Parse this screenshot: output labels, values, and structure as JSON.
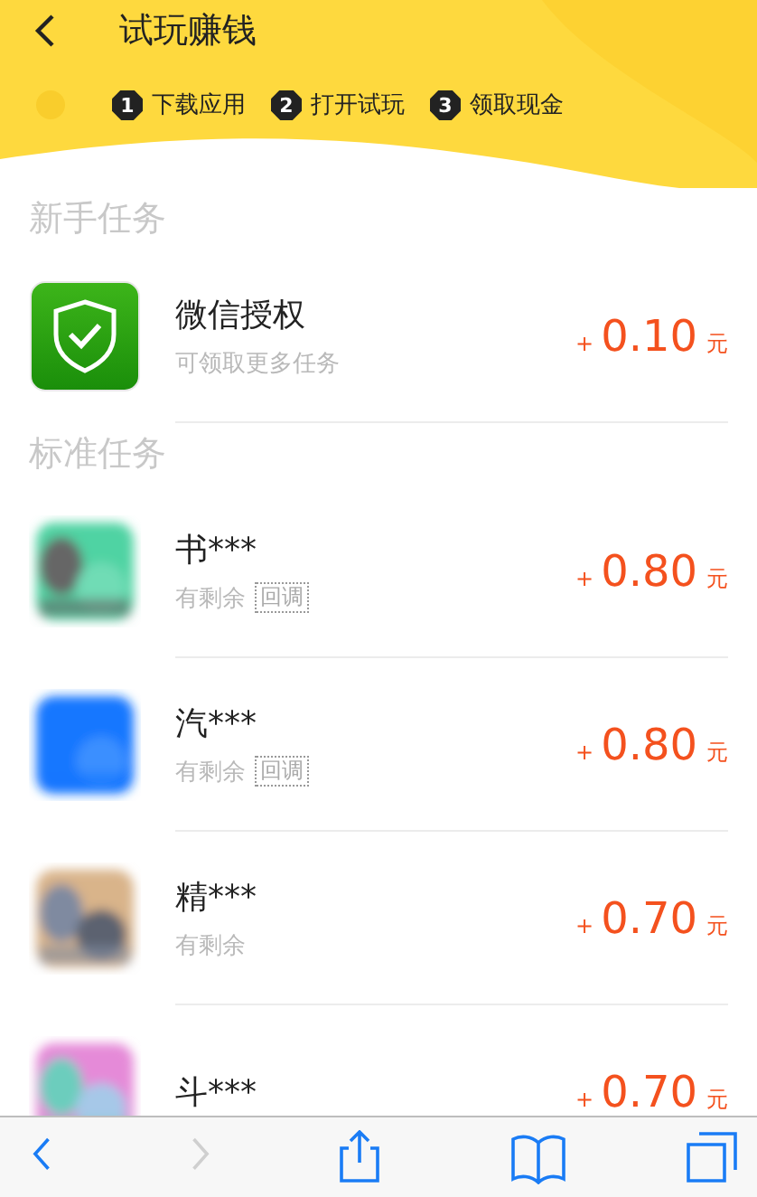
{
  "header": {
    "title": "试玩赚钱",
    "steps": [
      {
        "number": "1",
        "label": "下载应用"
      },
      {
        "number": "2",
        "label": "打开试玩"
      },
      {
        "number": "3",
        "label": "领取现金"
      }
    ]
  },
  "sections": [
    {
      "title": "新手任务",
      "tasks": [
        {
          "icon": {
            "kind": "shield"
          },
          "name": "微信授权",
          "subtitle": "可领取更多任务",
          "plus": "+",
          "amount": "0.10",
          "unit": "元"
        }
      ]
    },
    {
      "title": "标准任务",
      "tasks": [
        {
          "name": "书***",
          "subtitle": "有剩余",
          "tag": "回调",
          "plus": "+",
          "amount": "0.80",
          "unit": "元"
        },
        {
          "name": "汽***",
          "subtitle": "有剩余",
          "tag": "回调",
          "plus": "+",
          "amount": "0.80",
          "unit": "元"
        },
        {
          "name": "精***",
          "subtitle": "有剩余",
          "plus": "+",
          "amount": "0.70",
          "unit": "元"
        },
        {
          "name": "斗***",
          "plus": "+",
          "amount": "0.70",
          "unit": "元"
        }
      ]
    }
  ],
  "toolbar": [
    {
      "kind": "back",
      "disabled": false
    },
    {
      "kind": "forward",
      "disabled": true
    },
    {
      "kind": "share",
      "disabled": false
    },
    {
      "kind": "bookmarks",
      "disabled": false
    },
    {
      "kind": "tabs",
      "disabled": false
    }
  ]
}
